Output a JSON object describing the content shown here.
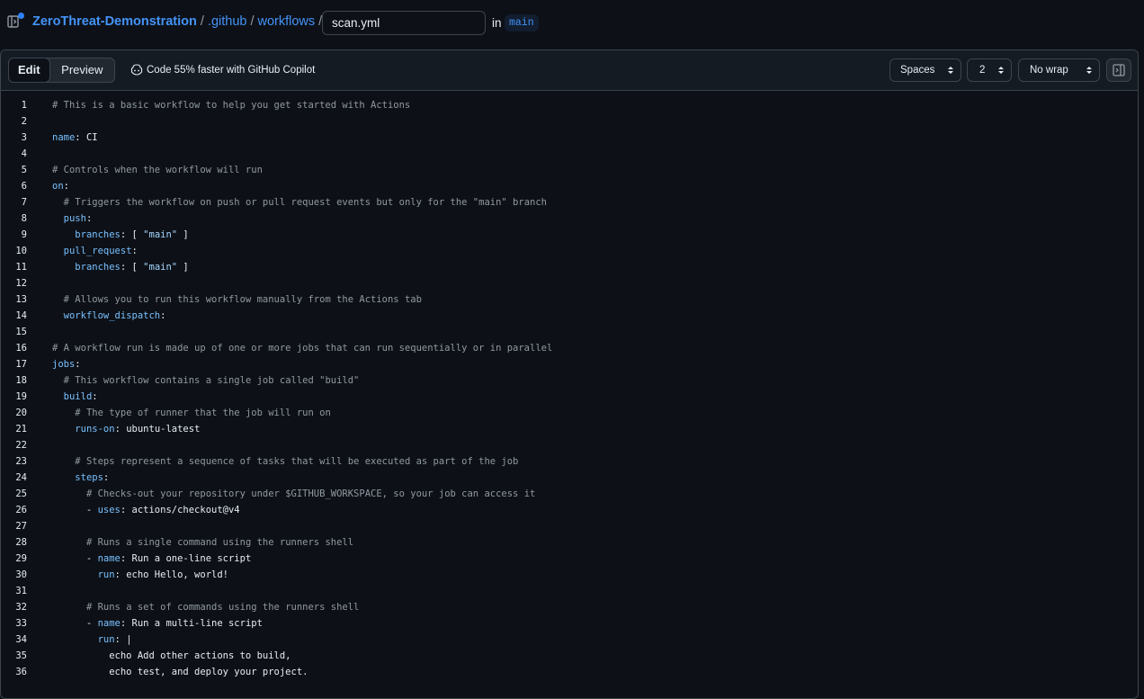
{
  "breadcrumb": {
    "repo": "ZeroThreat-Demonstration",
    "sep": "/",
    "folder1": ".github",
    "folder2": "workflows",
    "filename": "scan.yml",
    "in_label": "in",
    "branch": "main"
  },
  "toolbar": {
    "edit_label": "Edit",
    "preview_label": "Preview",
    "copilot_text": "Code 55% faster with GitHub Copilot",
    "indent_mode": "Spaces",
    "indent_size": "2",
    "wrap_mode": "No wrap"
  },
  "code_lines": [
    {
      "n": "1",
      "parts": [
        [
          "com",
          "# This is a basic workflow to help you get started with Actions"
        ]
      ]
    },
    {
      "n": "2",
      "parts": []
    },
    {
      "n": "3",
      "parts": [
        [
          "key",
          "name"
        ],
        [
          "val",
          ": CI"
        ]
      ]
    },
    {
      "n": "4",
      "parts": []
    },
    {
      "n": "5",
      "parts": [
        [
          "com",
          "# Controls when the workflow will run"
        ]
      ]
    },
    {
      "n": "6",
      "parts": [
        [
          "key",
          "on"
        ],
        [
          "val",
          ":"
        ]
      ]
    },
    {
      "n": "7",
      "parts": [
        [
          "val",
          "  "
        ],
        [
          "com",
          "# Triggers the workflow on push or pull request events but only for the \"main\" branch"
        ]
      ]
    },
    {
      "n": "8",
      "parts": [
        [
          "val",
          "  "
        ],
        [
          "key",
          "push"
        ],
        [
          "val",
          ":"
        ]
      ]
    },
    {
      "n": "9",
      "parts": [
        [
          "val",
          "    "
        ],
        [
          "key",
          "branches"
        ],
        [
          "val",
          ": [ "
        ],
        [
          "str",
          "\"main\""
        ],
        [
          "val",
          " ]"
        ]
      ]
    },
    {
      "n": "10",
      "parts": [
        [
          "val",
          "  "
        ],
        [
          "key",
          "pull_request"
        ],
        [
          "val",
          ":"
        ]
      ]
    },
    {
      "n": "11",
      "parts": [
        [
          "val",
          "    "
        ],
        [
          "key",
          "branches"
        ],
        [
          "val",
          ": [ "
        ],
        [
          "str",
          "\"main\""
        ],
        [
          "val",
          " ]"
        ]
      ]
    },
    {
      "n": "12",
      "parts": []
    },
    {
      "n": "13",
      "parts": [
        [
          "val",
          "  "
        ],
        [
          "com",
          "# Allows you to run this workflow manually from the Actions tab"
        ]
      ]
    },
    {
      "n": "14",
      "parts": [
        [
          "val",
          "  "
        ],
        [
          "key",
          "workflow_dispatch"
        ],
        [
          "val",
          ":"
        ]
      ]
    },
    {
      "n": "15",
      "parts": []
    },
    {
      "n": "16",
      "parts": [
        [
          "com",
          "# A workflow run is made up of one or more jobs that can run sequentially or in parallel"
        ]
      ]
    },
    {
      "n": "17",
      "parts": [
        [
          "key",
          "jobs"
        ],
        [
          "val",
          ":"
        ]
      ]
    },
    {
      "n": "18",
      "parts": [
        [
          "val",
          "  "
        ],
        [
          "com",
          "# This workflow contains a single job called \"build\""
        ]
      ]
    },
    {
      "n": "19",
      "parts": [
        [
          "val",
          "  "
        ],
        [
          "key",
          "build"
        ],
        [
          "val",
          ":"
        ]
      ]
    },
    {
      "n": "20",
      "parts": [
        [
          "val",
          "    "
        ],
        [
          "com",
          "# The type of runner that the job will run on"
        ]
      ]
    },
    {
      "n": "21",
      "parts": [
        [
          "val",
          "    "
        ],
        [
          "key",
          "runs-on"
        ],
        [
          "val",
          ": ubuntu-latest"
        ]
      ]
    },
    {
      "n": "22",
      "parts": []
    },
    {
      "n": "23",
      "parts": [
        [
          "val",
          "    "
        ],
        [
          "com",
          "# Steps represent a sequence of tasks that will be executed as part of the job"
        ]
      ]
    },
    {
      "n": "24",
      "parts": [
        [
          "val",
          "    "
        ],
        [
          "key",
          "steps"
        ],
        [
          "val",
          ":"
        ]
      ]
    },
    {
      "n": "25",
      "parts": [
        [
          "val",
          "      "
        ],
        [
          "com",
          "# Checks-out your repository under $GITHUB_WORKSPACE, so your job can access it"
        ]
      ]
    },
    {
      "n": "26",
      "parts": [
        [
          "val",
          "      - "
        ],
        [
          "key",
          "uses"
        ],
        [
          "val",
          ": actions/checkout@v4"
        ]
      ]
    },
    {
      "n": "27",
      "parts": []
    },
    {
      "n": "28",
      "parts": [
        [
          "val",
          "      "
        ],
        [
          "com",
          "# Runs a single command using the runners shell"
        ]
      ]
    },
    {
      "n": "29",
      "parts": [
        [
          "val",
          "      - "
        ],
        [
          "key",
          "name"
        ],
        [
          "val",
          ": Run a one-line script"
        ]
      ]
    },
    {
      "n": "30",
      "parts": [
        [
          "val",
          "        "
        ],
        [
          "key",
          "run"
        ],
        [
          "val",
          ": echo Hello, world!"
        ]
      ]
    },
    {
      "n": "31",
      "parts": []
    },
    {
      "n": "32",
      "parts": [
        [
          "val",
          "      "
        ],
        [
          "com",
          "# Runs a set of commands using the runners shell"
        ]
      ]
    },
    {
      "n": "33",
      "parts": [
        [
          "val",
          "      - "
        ],
        [
          "key",
          "name"
        ],
        [
          "val",
          ": Run a multi-line script"
        ]
      ]
    },
    {
      "n": "34",
      "parts": [
        [
          "val",
          "        "
        ],
        [
          "key",
          "run"
        ],
        [
          "val",
          ": |"
        ]
      ]
    },
    {
      "n": "35",
      "parts": [
        [
          "val",
          "          echo Add other actions to build,"
        ]
      ]
    },
    {
      "n": "36",
      "parts": [
        [
          "val",
          "          echo test, and deploy your project."
        ]
      ]
    }
  ]
}
